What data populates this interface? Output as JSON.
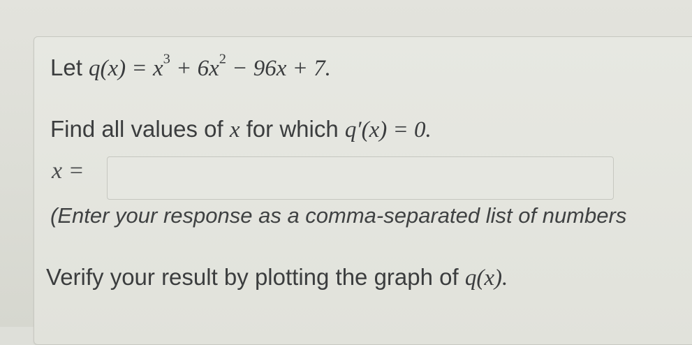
{
  "question": {
    "let_text": "Let",
    "definition": "q(x) = x³ + 6x² − 96x + 7.",
    "definition_parts": {
      "lhs": "q(x) = x",
      "exp1": "3",
      "mid": " + 6x",
      "exp2": "2",
      "rest": " − 96x + 7."
    },
    "instruction_prefix": "Find all values of",
    "instruction_var": "x",
    "instruction_middle": "for which",
    "instruction_condition": "q′(x) = 0."
  },
  "answer": {
    "label": "x =",
    "value": "",
    "placeholder": ""
  },
  "hint": {
    "text": "(Enter your response as a comma-separated list of numbers"
  },
  "verify": {
    "text_prefix": "Verify your result by plotting the graph of",
    "function": "q(x)."
  }
}
